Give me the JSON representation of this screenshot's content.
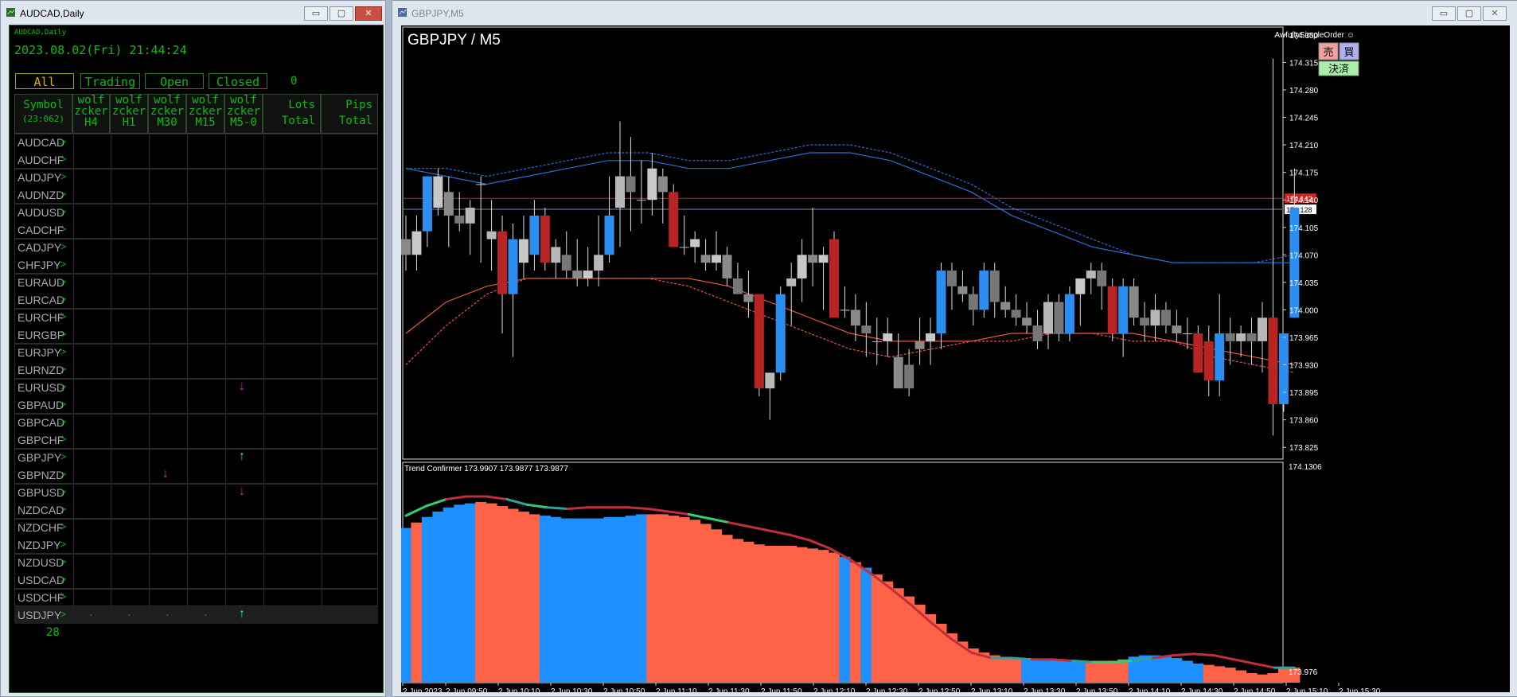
{
  "left_window": {
    "title": "AUDCAD,Daily",
    "small_label": "AUDCAD,Daily",
    "datetime": "2023.08.02(Fri) 21:44:24",
    "filters": [
      "All",
      "Trading",
      "Open",
      "Closed"
    ],
    "count": "0",
    "headers": {
      "symbol": [
        "Symbol",
        "(23:062)"
      ],
      "h4": [
        "wolf",
        "zcker",
        "H4"
      ],
      "h1": [
        "wolf",
        "zcker",
        "H1"
      ],
      "m30": [
        "wolf",
        "zcker",
        "M30"
      ],
      "m15": [
        "wolf",
        "zcker",
        "M15"
      ],
      "m5": [
        "wolf",
        "zcker",
        "M5-0"
      ],
      "lots": [
        "Lots",
        "Total"
      ],
      "pips": [
        "Pips",
        "Total"
      ]
    },
    "symbols": [
      "AUDCAD",
      "AUDCHF",
      "AUDJPY",
      "AUDNZD",
      "AUDUSD",
      "CADCHF",
      "CADJPY",
      "CHFJPY",
      "EURAUD",
      "EURCAD",
      "EURCHF",
      "EURGBP",
      "EURJPY",
      "EURNZD",
      "EURUSD",
      "GBPAUD",
      "GBPCAD",
      "GBPCHF",
      "GBPJPY",
      "GBPNZD",
      "GBPUSD",
      "NZDCAD",
      "NZDCHF",
      "NZDJPY",
      "NZDUSD",
      "USDCAD",
      "USDCHF",
      "USDJPY"
    ],
    "signals": [
      {
        "symbol_index": 14,
        "column": "m5",
        "direction": "down",
        "glyph": "↓",
        "color": "#e020e0"
      },
      {
        "symbol_index": 18,
        "column": "m5",
        "direction": "up",
        "glyph": "↑",
        "color": "#20e0e0"
      },
      {
        "symbol_index": 19,
        "column": "m30",
        "direction": "down",
        "glyph": "↓",
        "color": "#e020e0"
      },
      {
        "symbol_index": 20,
        "column": "m5",
        "direction": "down",
        "glyph": "↓",
        "color": "#e020e0"
      },
      {
        "symbol_index": 27,
        "column": "m5",
        "direction": "up",
        "glyph": "↑",
        "color": "#20e0e0"
      }
    ],
    "usdjpy_dashes": [
      "-",
      "-",
      "-",
      "-"
    ],
    "total_count": "28"
  },
  "right_window": {
    "title": "GBPJPY,M5",
    "chart_title": "GBPJPY / M5",
    "ea_name": "AwfullySimpleOrder ☺",
    "btn_sell": "売",
    "btn_buy": "買",
    "btn_close": "決済",
    "price_labels": [
      "174.350",
      "174.315",
      "174.280",
      "174.245",
      "174.210",
      "174.175",
      "174.140",
      "174.105",
      "174.070",
      "174.035",
      "174.000",
      "173.965",
      "173.930",
      "173.895",
      "173.860",
      "173.825"
    ],
    "current_price_red": "174.142",
    "current_price": "174.128",
    "indicator_label": "Trend Confirmer 173.9907 173.9877 173.9877",
    "indicator_max": "174.1306",
    "indicator_min": "173.976",
    "time_labels": [
      "2 Jun 2023",
      "2 Jun 09:50",
      "2 Jun 10:10",
      "2 Jun 10:30",
      "2 Jun 10:50",
      "2 Jun 11:10",
      "2 Jun 11:30",
      "2 Jun 11:50",
      "2 Jun 12:10",
      "2 Jun 12:30",
      "2 Jun 12:50",
      "2 Jun 13:10",
      "2 Jun 13:30",
      "2 Jun 13:50",
      "2 Jun 14:10",
      "2 Jun 14:30",
      "2 Jun 14:50",
      "2 Jun 15:10",
      "2 Jun 15:30"
    ]
  },
  "chart_data": {
    "type": "candlestick",
    "symbol": "GBPJPY",
    "timeframe": "M5",
    "y_range": [
      173.81,
      174.36
    ],
    "candles": [
      [
        174.09,
        174.12,
        174.05,
        174.07
      ],
      [
        174.07,
        174.12,
        174.05,
        174.1
      ],
      [
        174.1,
        174.17,
        174.08,
        174.17
      ],
      [
        174.13,
        174.18,
        174.12,
        174.17
      ],
      [
        174.15,
        174.17,
        174.08,
        174.12
      ],
      [
        174.12,
        174.15,
        174.1,
        174.11
      ],
      [
        174.11,
        174.14,
        174.07,
        174.13
      ],
      [
        174.16,
        174.17,
        174.06,
        174.16
      ],
      [
        174.09,
        174.14,
        174.05,
        174.1
      ],
      [
        174.1,
        174.12,
        173.97,
        174.02
      ],
      [
        174.02,
        174.11,
        173.94,
        174.09
      ],
      [
        174.06,
        174.12,
        174.04,
        174.09
      ],
      [
        174.07,
        174.14,
        174.05,
        174.12
      ],
      [
        174.12,
        174.13,
        174.05,
        174.06
      ],
      [
        174.06,
        174.09,
        174.04,
        174.08
      ],
      [
        174.07,
        174.1,
        174.04,
        174.05
      ],
      [
        174.05,
        174.09,
        174.03,
        174.04
      ],
      [
        174.04,
        174.08,
        174.03,
        174.05
      ],
      [
        174.05,
        174.12,
        174.03,
        174.07
      ],
      [
        174.07,
        174.17,
        174.06,
        174.12
      ],
      [
        174.13,
        174.24,
        174.08,
        174.17
      ],
      [
        174.17,
        174.22,
        174.1,
        174.15
      ],
      [
        174.14,
        174.19,
        174.11,
        174.14
      ],
      [
        174.14,
        174.2,
        174.12,
        174.18
      ],
      [
        174.17,
        174.18,
        174.11,
        174.15
      ],
      [
        174.15,
        174.16,
        174.08,
        174.08
      ],
      [
        174.08,
        174.12,
        174.07,
        174.08
      ],
      [
        174.08,
        174.1,
        174.06,
        174.09
      ],
      [
        174.07,
        174.09,
        174.05,
        174.06
      ],
      [
        174.06,
        174.1,
        174.05,
        174.07
      ],
      [
        174.07,
        174.08,
        174.03,
        174.04
      ],
      [
        174.04,
        174.06,
        174.02,
        174.02
      ],
      [
        174.02,
        174.05,
        173.99,
        174.01
      ],
      [
        174.02,
        174.02,
        173.89,
        173.9
      ],
      [
        173.9,
        173.92,
        173.86,
        173.92
      ],
      [
        173.92,
        174.03,
        173.91,
        174.02
      ],
      [
        174.03,
        174.06,
        173.98,
        174.04
      ],
      [
        174.04,
        174.09,
        174.01,
        174.07
      ],
      [
        174.07,
        174.13,
        174.03,
        174.06
      ],
      [
        174.06,
        174.08,
        174.0,
        174.07
      ],
      [
        174.09,
        174.1,
        174.0,
        173.99
      ],
      [
        174.0,
        174.03,
        173.99,
        174.0
      ],
      [
        174.0,
        174.02,
        173.96,
        173.98
      ],
      [
        173.98,
        174.01,
        173.94,
        173.97
      ],
      [
        173.96,
        173.99,
        173.93,
        173.96
      ],
      [
        173.96,
        173.99,
        173.94,
        173.97
      ],
      [
        173.94,
        173.97,
        173.92,
        173.9
      ],
      [
        173.93,
        173.95,
        173.89,
        173.9
      ],
      [
        173.96,
        173.99,
        173.93,
        173.95
      ],
      [
        173.96,
        173.99,
        173.93,
        173.97
      ],
      [
        173.97,
        174.06,
        173.95,
        174.05
      ],
      [
        174.05,
        174.06,
        174.0,
        174.03
      ],
      [
        174.03,
        174.05,
        174.01,
        174.02
      ],
      [
        174.02,
        174.03,
        173.98,
        174.0
      ],
      [
        174.0,
        174.06,
        173.99,
        174.05
      ],
      [
        174.05,
        174.06,
        173.99,
        174.01
      ],
      [
        174.01,
        174.03,
        173.99,
        174.0
      ],
      [
        174.0,
        174.02,
        173.98,
        173.99
      ],
      [
        173.99,
        174.01,
        173.97,
        173.98
      ],
      [
        173.98,
        174.0,
        173.95,
        173.96
      ],
      [
        173.97,
        174.02,
        173.95,
        174.01
      ],
      [
        174.01,
        174.02,
        173.96,
        173.97
      ],
      [
        173.97,
        174.03,
        173.96,
        174.02
      ],
      [
        174.02,
        174.04,
        173.98,
        174.04
      ],
      [
        174.04,
        174.06,
        174.02,
        174.05
      ],
      [
        174.05,
        174.06,
        174.0,
        174.03
      ],
      [
        174.03,
        174.04,
        173.96,
        173.97
      ],
      [
        173.97,
        174.04,
        173.94,
        174.03
      ],
      [
        174.03,
        174.04,
        173.98,
        173.99
      ],
      [
        173.99,
        174.01,
        173.96,
        173.98
      ],
      [
        173.98,
        174.02,
        173.96,
        174.0
      ],
      [
        174.0,
        174.01,
        173.97,
        173.98
      ],
      [
        173.98,
        174.0,
        173.96,
        173.97
      ],
      [
        173.97,
        173.99,
        173.95,
        173.97
      ],
      [
        173.97,
        173.98,
        173.92,
        173.92
      ],
      [
        173.96,
        173.98,
        173.89,
        173.91
      ],
      [
        173.91,
        174.02,
        173.89,
        173.97
      ],
      [
        173.97,
        173.99,
        173.93,
        173.96
      ],
      [
        173.96,
        173.98,
        173.94,
        173.97
      ],
      [
        173.97,
        173.99,
        173.93,
        173.96
      ],
      [
        173.96,
        174.01,
        173.92,
        173.99
      ],
      [
        173.99,
        174.32,
        173.84,
        173.88
      ],
      [
        173.88,
        173.97,
        173.87,
        173.97
      ],
      [
        173.99,
        174.18,
        173.99,
        174.13
      ]
    ],
    "series": [
      {
        "name": "",
        "color": "#2a6fd6",
        "style": "solid",
        "values": [
          174.18,
          174.17,
          174.16,
          174.17,
          174.18,
          174.19,
          174.19,
          174.18,
          174.18,
          174.19,
          174.2,
          174.2,
          174.19,
          174.17,
          174.15,
          174.12,
          174.1,
          174.08,
          174.07,
          174.06,
          174.06,
          174.06,
          174.06
        ]
      },
      {
        "name": "",
        "color": "#2a6fd6",
        "style": "dashed",
        "values": [
          174.18,
          174.18,
          174.17,
          174.18,
          174.19,
          174.2,
          174.2,
          174.19,
          174.19,
          174.2,
          174.21,
          174.21,
          174.2,
          174.18,
          174.16,
          174.13,
          174.11,
          174.09,
          174.07,
          174.06,
          174.06,
          174.06,
          174.07
        ]
      },
      {
        "name": "",
        "color": "#e8563a",
        "style": "solid",
        "values": [
          173.97,
          174.01,
          174.03,
          174.04,
          174.04,
          174.04,
          174.04,
          174.04,
          174.03,
          174.01,
          173.99,
          173.97,
          173.96,
          173.96,
          173.96,
          173.97,
          173.97,
          173.97,
          173.97,
          173.96,
          173.95,
          173.94,
          173.93
        ]
      },
      {
        "name": "",
        "color": "#e8563a",
        "style": "dashed",
        "values": [
          173.93,
          173.98,
          174.02,
          174.04,
          174.04,
          174.04,
          174.04,
          174.03,
          174.01,
          173.99,
          173.97,
          173.95,
          173.94,
          173.95,
          173.96,
          173.96,
          173.97,
          173.97,
          173.96,
          173.96,
          173.94,
          173.93,
          173.92
        ]
      }
    ],
    "hlines": [
      {
        "value": 174.142,
        "color": "#d02020"
      },
      {
        "value": 174.128,
        "color": "#7088c0"
      }
    ],
    "indicator": {
      "name": "Trend Confirmer",
      "y_range": [
        173.976,
        174.1306
      ],
      "bar_colors": {
        "up": "#1e90ff",
        "down": "#ff6347"
      },
      "bar_values": [
        174.089,
        174.093,
        174.097,
        174.101,
        174.104,
        174.106,
        174.107,
        174.108,
        174.107,
        174.105,
        174.103,
        174.101,
        174.099,
        174.098,
        174.097,
        174.096,
        174.096,
        174.096,
        174.096,
        174.097,
        174.097,
        174.098,
        174.099,
        174.099,
        174.099,
        174.098,
        174.097,
        174.095,
        174.092,
        174.088,
        174.084,
        174.081,
        174.079,
        174.077,
        174.076,
        174.076,
        174.076,
        174.075,
        174.074,
        174.073,
        174.071,
        174.068,
        174.064,
        174.06,
        174.055,
        174.05,
        174.045,
        174.039,
        174.033,
        174.026,
        174.019,
        174.012,
        174.006,
        174.001,
        173.998,
        173.996,
        173.994,
        173.994,
        173.993,
        173.993,
        173.993,
        173.993,
        173.992,
        173.992,
        173.992,
        173.992,
        173.992,
        173.993,
        173.995,
        173.996,
        173.996,
        173.995,
        173.994,
        173.992,
        173.99,
        173.989,
        173.988,
        173.987,
        173.985,
        173.983,
        173.982,
        173.983,
        173.987,
        173.987
      ],
      "bar_dirs": [
        "u",
        "d",
        "u",
        "u",
        "u",
        "u",
        "u",
        "d",
        "d",
        "d",
        "d",
        "d",
        "d",
        "u",
        "u",
        "u",
        "u",
        "u",
        "u",
        "u",
        "u",
        "u",
        "u",
        "d",
        "d",
        "d",
        "d",
        "d",
        "d",
        "d",
        "d",
        "d",
        "d",
        "d",
        "d",
        "d",
        "d",
        "d",
        "d",
        "d",
        "d",
        "u",
        "d",
        "u",
        "d",
        "d",
        "d",
        "d",
        "d",
        "d",
        "d",
        "d",
        "d",
        "d",
        "d",
        "d",
        "d",
        "d",
        "u",
        "u",
        "u",
        "u",
        "u",
        "u",
        "d",
        "d",
        "d",
        "d",
        "u",
        "u",
        "u",
        "u",
        "u",
        "u",
        "u",
        "d",
        "d",
        "d",
        "d",
        "d",
        "d",
        "d",
        "d",
        "d",
        "d",
        "d",
        "u",
        "u",
        "u"
      ],
      "line_values": [
        174.098,
        174.105,
        174.11,
        174.112,
        174.112,
        174.11,
        174.106,
        174.104,
        174.103,
        174.104,
        174.104,
        174.104,
        174.103,
        174.101,
        174.099,
        174.096,
        174.093,
        174.09,
        174.087,
        174.084,
        174.08,
        174.074,
        174.066,
        174.056,
        174.045,
        174.033,
        174.02,
        174.008,
        173.998,
        173.994,
        173.994,
        173.993,
        173.993,
        173.992,
        173.991,
        173.991,
        173.992,
        173.994,
        173.996,
        173.997,
        173.996,
        173.993,
        173.99,
        173.987,
        173.987
      ],
      "line_colors": [
        "#30d070",
        "#30d070",
        "#c0303a",
        "#c0303a",
        "#c0303a",
        "#30a0a0",
        "#30d070",
        "#30a0a0",
        "#c0303a",
        "#c0303a",
        "#c0303a",
        "#c0303a",
        "#c0303a",
        "#c0303a",
        "#30d070",
        "#30d070",
        "#c0303a",
        "#c0303a",
        "#c0303a",
        "#c0303a",
        "#c0303a",
        "#c0303a",
        "#c0303a",
        "#c0303a",
        "#c0303a",
        "#c0303a",
        "#c0303a",
        "#c0303a",
        "#c0303a",
        "#30a0a0",
        "#30a0a0",
        "#c0303a",
        "#c0303a",
        "#30a0a0",
        "#30d070",
        "#30d070",
        "#30a0a0",
        "#c0303a",
        "#c0303a",
        "#c0303a",
        "#c0303a",
        "#c0303a",
        "#c0303a",
        "#30a0a0",
        "#30a0a0"
      ]
    }
  }
}
